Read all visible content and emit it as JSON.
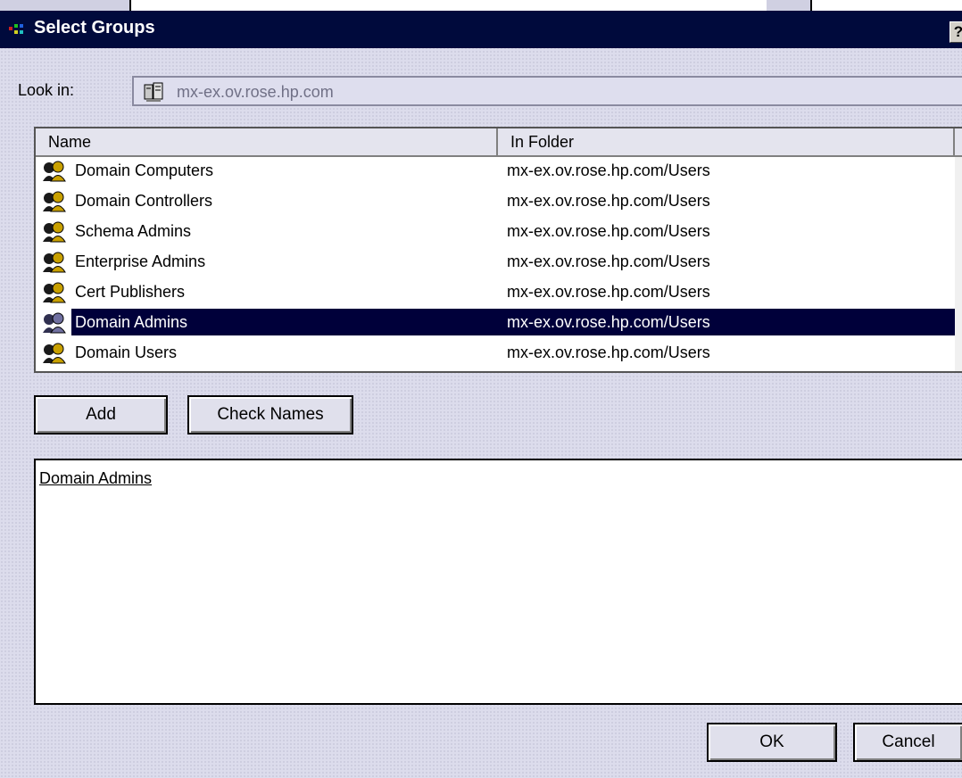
{
  "window": {
    "title": "Select Groups",
    "help_label": "?"
  },
  "look_in": {
    "label": "Look in:",
    "value": "mx-ex.ov.rose.hp.com"
  },
  "list": {
    "columns": [
      "Name",
      "In Folder"
    ],
    "rows": [
      {
        "name": "Domain Computers",
        "folder": "mx-ex.ov.rose.hp.com/Users"
      },
      {
        "name": "Domain Controllers",
        "folder": "mx-ex.ov.rose.hp.com/Users"
      },
      {
        "name": "Schema Admins",
        "folder": "mx-ex.ov.rose.hp.com/Users"
      },
      {
        "name": "Enterprise Admins",
        "folder": "mx-ex.ov.rose.hp.com/Users"
      },
      {
        "name": "Cert Publishers",
        "folder": "mx-ex.ov.rose.hp.com/Users"
      },
      {
        "name": "Domain Admins",
        "folder": "mx-ex.ov.rose.hp.com/Users",
        "selected": true
      },
      {
        "name": "Domain Users",
        "folder": "mx-ex.ov.rose.hp.com/Users"
      }
    ]
  },
  "buttons": {
    "add": "Add",
    "check_names": "Check Names",
    "ok": "OK",
    "cancel": "Cancel"
  },
  "selected_items": {
    "text": "Domain Admins"
  },
  "icons": {
    "group": "group-icon",
    "server": "server-icon"
  },
  "colors": {
    "titlebar": "#000a3c",
    "selection": "#00003a",
    "dialog_bg": "#dcdcec"
  }
}
